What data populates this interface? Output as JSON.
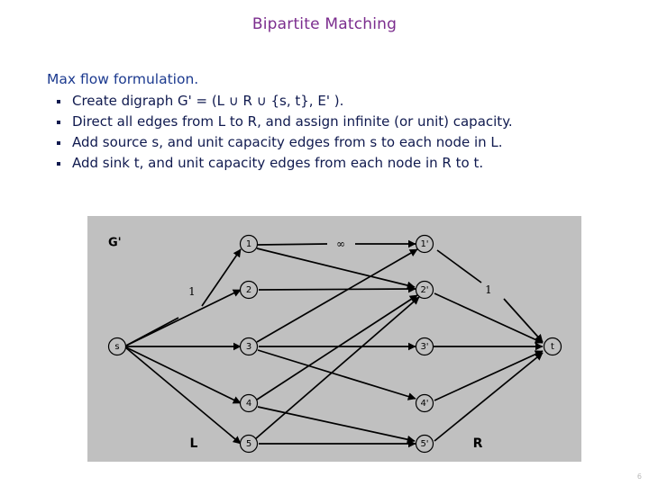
{
  "slide": {
    "title": "Bipartite Matching",
    "title_color": "#7b2d8e",
    "page_number": "6",
    "body": {
      "lead": "Max flow formulation.",
      "bullets": [
        "Create digraph G' = (L ∪ R ∪ {s, t},  E' ).",
        "Direct all edges from L to R, and assign infinite (or unit) capacity.",
        "Add source s, and unit capacity edges from s to each node in L.",
        "Add sink t, and unit capacity edges from each node in R to t."
      ]
    }
  },
  "diagram": {
    "panel_color": "#c0c0c0",
    "graph_name": "G'",
    "left_set_label": "L",
    "right_set_label": "R",
    "source_label": "s",
    "sink_label": "t",
    "left_nodes": [
      "1",
      "2",
      "3",
      "4",
      "5"
    ],
    "right_nodes": [
      "1'",
      "2'",
      "3'",
      "4'",
      "5'"
    ],
    "capacity_labels": {
      "source_edge": "1",
      "middle_edge": "∞",
      "sink_edge": "1"
    },
    "matching_edges": [
      [
        "1",
        "1'"
      ],
      [
        "1",
        "2'"
      ],
      [
        "2",
        "2'"
      ],
      [
        "3",
        "1'"
      ],
      [
        "3",
        "3'"
      ],
      [
        "3",
        "4'"
      ],
      [
        "4",
        "2'"
      ],
      [
        "4",
        "5'"
      ],
      [
        "5",
        "2'"
      ],
      [
        "5",
        "5'"
      ]
    ]
  }
}
